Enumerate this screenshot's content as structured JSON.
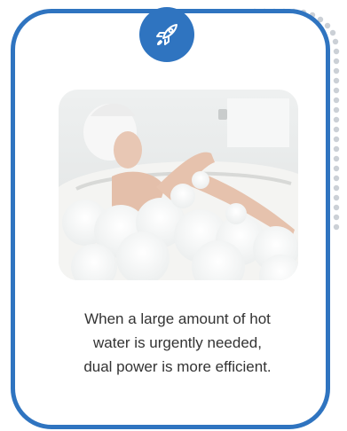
{
  "badge": {
    "icon": "rocket-icon",
    "color": "#2f74c0"
  },
  "card": {
    "border_color": "#2f74c0",
    "dots_color": "#cbd0d6"
  },
  "photo": {
    "subject": "woman-in-bubble-bath"
  },
  "caption": {
    "line1": "When a large amount of hot",
    "line2": "water is urgently needed,",
    "line3": "dual power is more efficient."
  }
}
